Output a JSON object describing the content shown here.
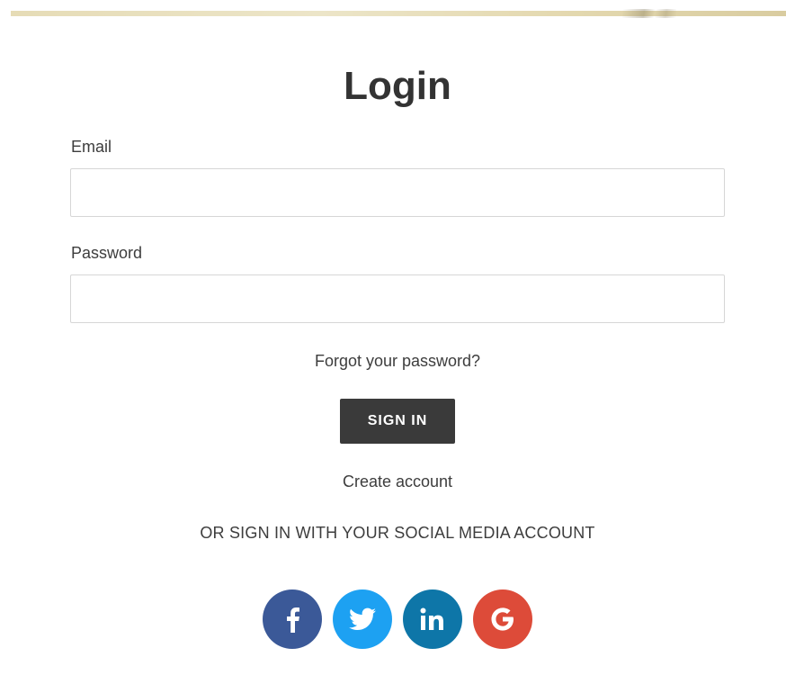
{
  "page": {
    "title": "Login"
  },
  "form": {
    "email_label": "Email",
    "email_value": "",
    "password_label": "Password",
    "password_value": "",
    "forgot_link": "Forgot your password?",
    "signin_label": "SIGN IN",
    "create_account_link": "Create account"
  },
  "social": {
    "caption": "OR SIGN IN WITH YOUR SOCIAL MEDIA ACCOUNT",
    "buttons": [
      {
        "name": "facebook",
        "icon": "facebook-icon",
        "color": "#3b5998"
      },
      {
        "name": "twitter",
        "icon": "twitter-icon",
        "color": "#1da1f2"
      },
      {
        "name": "linkedin",
        "icon": "linkedin-icon",
        "color": "#0e76a8"
      },
      {
        "name": "google",
        "icon": "google-icon",
        "color": "#dd4b39"
      }
    ]
  },
  "colors": {
    "button_bg": "#3a3a3a",
    "text": "#3d3d3d",
    "input_border": "#d6d6d6"
  }
}
